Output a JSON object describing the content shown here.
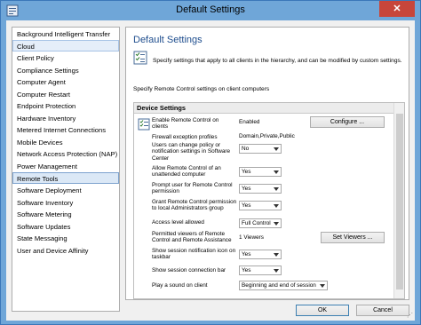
{
  "window": {
    "title": "Default Settings",
    "close_glyph": "✕"
  },
  "nav": {
    "items": [
      {
        "label": "Background Intelligent Transfer"
      },
      {
        "label": "Cloud"
      },
      {
        "label": "Client Policy"
      },
      {
        "label": "Compliance Settings"
      },
      {
        "label": "Computer Agent"
      },
      {
        "label": "Computer Restart"
      },
      {
        "label": "Endpoint Protection"
      },
      {
        "label": "Hardware Inventory"
      },
      {
        "label": "Metered Internet Connections"
      },
      {
        "label": "Mobile Devices"
      },
      {
        "label": "Network Access Protection (NAP)"
      },
      {
        "label": "Power Management"
      },
      {
        "label": "Remote Tools"
      },
      {
        "label": "Software Deployment"
      },
      {
        "label": "Software Inventory"
      },
      {
        "label": "Software Metering"
      },
      {
        "label": "Software Updates"
      },
      {
        "label": "State Messaging"
      },
      {
        "label": "User and Device Affinity"
      }
    ],
    "highlighted_index": 1,
    "selected_index": 12
  },
  "panel": {
    "title": "Default Settings",
    "description": "Specify settings that apply to all clients in the hierarchy, and can be modified by custom settings.",
    "subheading": "Specify Remote Control settings on client computers",
    "group_header": "Device Settings"
  },
  "settings": {
    "enable": {
      "label": "Enable Remote Control on clients",
      "value": "Enabled",
      "button": "Configure ..."
    },
    "firewall": {
      "label": "Firewall exception profiles",
      "value": "Domain,Private,Public"
    },
    "users_change": {
      "label": "Users can change policy or notification settings in Software Center",
      "value": "No"
    },
    "unattended": {
      "label": "Allow Remote Control of an unattended computer",
      "value": "Yes"
    },
    "prompt": {
      "label": "Prompt user for Remote Control permission",
      "value": "Yes"
    },
    "grant": {
      "label": "Grant Remote Control permission to local Administrators group",
      "value": "Yes"
    },
    "access": {
      "label": "Access level allowed",
      "value": "Full Control"
    },
    "viewers": {
      "label": "Permitted viewers of Remote Control and Remote Assistance",
      "value": "1 Viewers",
      "button": "Set Viewers ..."
    },
    "notif_icon": {
      "label": "Show session notification icon on taskbar",
      "value": "Yes"
    },
    "conn_bar": {
      "label": "Show session connection bar",
      "value": "Yes"
    },
    "sound": {
      "label": "Play a sound on client",
      "value": "Beginning and end of session"
    }
  },
  "footer": {
    "ok": "OK",
    "cancel": "Cancel"
  },
  "colors": {
    "window_frame": "#6fa6d8",
    "close_button": "#c7463b",
    "title_text": "#1f4e8e",
    "selection": "#dbe8f6"
  }
}
